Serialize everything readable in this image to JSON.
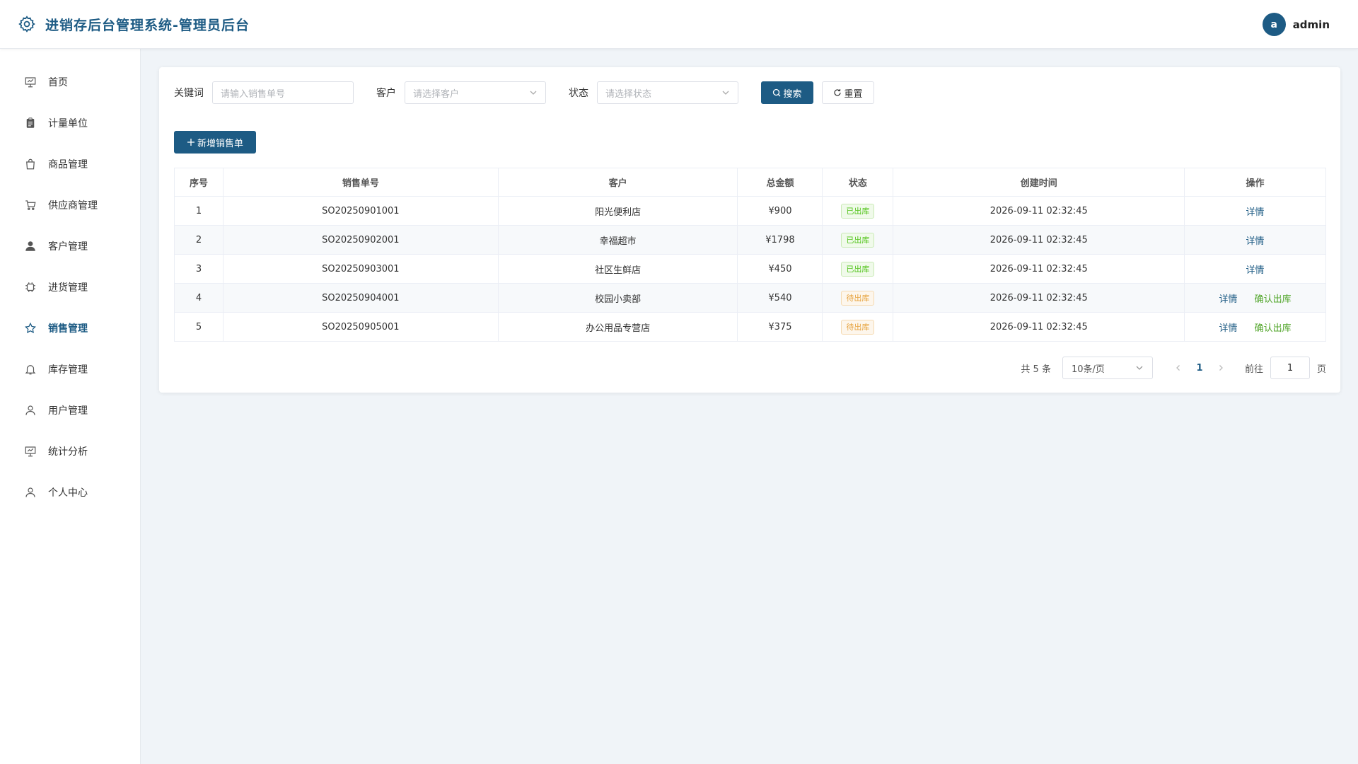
{
  "header": {
    "title": "进销存后台管理系统-管理员后台",
    "avatar_letter": "a",
    "username": "admin"
  },
  "sidebar": {
    "items": [
      {
        "label": "首页",
        "icon": "presentation-icon",
        "active": false
      },
      {
        "label": "计量单位",
        "icon": "clipboard-icon",
        "active": false
      },
      {
        "label": "商品管理",
        "icon": "shopping-bag-icon",
        "active": false
      },
      {
        "label": "供应商管理",
        "icon": "cart-icon",
        "active": false
      },
      {
        "label": "客户管理",
        "icon": "user-filled-icon",
        "active": false
      },
      {
        "label": "进货管理",
        "icon": "chip-icon",
        "active": false
      },
      {
        "label": "销售管理",
        "icon": "star-icon",
        "active": true
      },
      {
        "label": "库存管理",
        "icon": "bell-icon",
        "active": false
      },
      {
        "label": "用户管理",
        "icon": "user-icon",
        "active": false
      },
      {
        "label": "统计分析",
        "icon": "presentation-icon",
        "active": false
      },
      {
        "label": "个人中心",
        "icon": "user-icon",
        "active": false
      }
    ]
  },
  "filters": {
    "keyword_label": "关键词",
    "keyword_placeholder": "请输入销售单号",
    "customer_label": "客户",
    "customer_placeholder": "请选择客户",
    "status_label": "状态",
    "status_placeholder": "请选择状态",
    "search_label": "搜索",
    "reset_label": "重置"
  },
  "add_button_label": "新增销售单",
  "table": {
    "headers": [
      "序号",
      "销售单号",
      "客户",
      "总金额",
      "状态",
      "创建时间",
      "操作"
    ],
    "rows": [
      {
        "index": "1",
        "order_no": "SO20250901001",
        "customer": "阳光便利店",
        "amount": "¥900",
        "status": "已出库",
        "status_type": "green",
        "created": "2026-09-11 02:32:45",
        "actions": [
          "详情"
        ]
      },
      {
        "index": "2",
        "order_no": "SO20250902001",
        "customer": "幸福超市",
        "amount": "¥1798",
        "status": "已出库",
        "status_type": "green",
        "created": "2026-09-11 02:32:45",
        "actions": [
          "详情"
        ]
      },
      {
        "index": "3",
        "order_no": "SO20250903001",
        "customer": "社区生鲜店",
        "amount": "¥450",
        "status": "已出库",
        "status_type": "green",
        "created": "2026-09-11 02:32:45",
        "actions": [
          "详情"
        ]
      },
      {
        "index": "4",
        "order_no": "SO20250904001",
        "customer": "校园小卖部",
        "amount": "¥540",
        "status": "待出库",
        "status_type": "orange",
        "created": "2026-09-11 02:32:45",
        "actions": [
          "详情",
          "确认出库"
        ]
      },
      {
        "index": "5",
        "order_no": "SO20250905001",
        "customer": "办公用品专营店",
        "amount": "¥375",
        "status": "待出库",
        "status_type": "orange",
        "created": "2026-09-11 02:32:45",
        "actions": [
          "详情",
          "确认出库"
        ]
      }
    ]
  },
  "pagination": {
    "total_text": "共 5 条",
    "page_size": "10条/页",
    "current_page": "1",
    "goto_label": "前往",
    "goto_value": "1",
    "page_suffix": "页"
  },
  "colors": {
    "primary": "#1d5b84",
    "success": "#52c41a",
    "warning": "#e6a23c"
  }
}
